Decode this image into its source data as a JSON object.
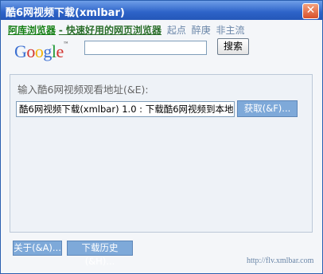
{
  "window": {
    "title": "酷6网视频下载(xmlbar)",
    "close_label": "✕"
  },
  "links": {
    "main": "阿库浏览器",
    "sub": "- 快速好用的网页浏览器",
    "extras": [
      "起点",
      "醉庚",
      "非主流"
    ]
  },
  "google": {
    "logo_letters": [
      "G",
      "o",
      "o",
      "g",
      "l",
      "e"
    ],
    "logo_colors": [
      "#3b6fd1",
      "#d2322d",
      "#f2b30b",
      "#3b6fd1",
      "#249a3a",
      "#d2322d"
    ],
    "tm": "™",
    "search_value": "",
    "search_button": "搜索"
  },
  "group": {
    "label": "输入酷6网视频观看地址(&E):",
    "url_value": "酷6网视频下载(xmlbar) 1.0 : 下载酷6网视频到本地",
    "fetch_button": "获取(&F)..."
  },
  "footer": {
    "about_button": "关于(&A)...",
    "history_button": "下载历史(&H)...",
    "site": "http://flv.xmlbar.com"
  }
}
